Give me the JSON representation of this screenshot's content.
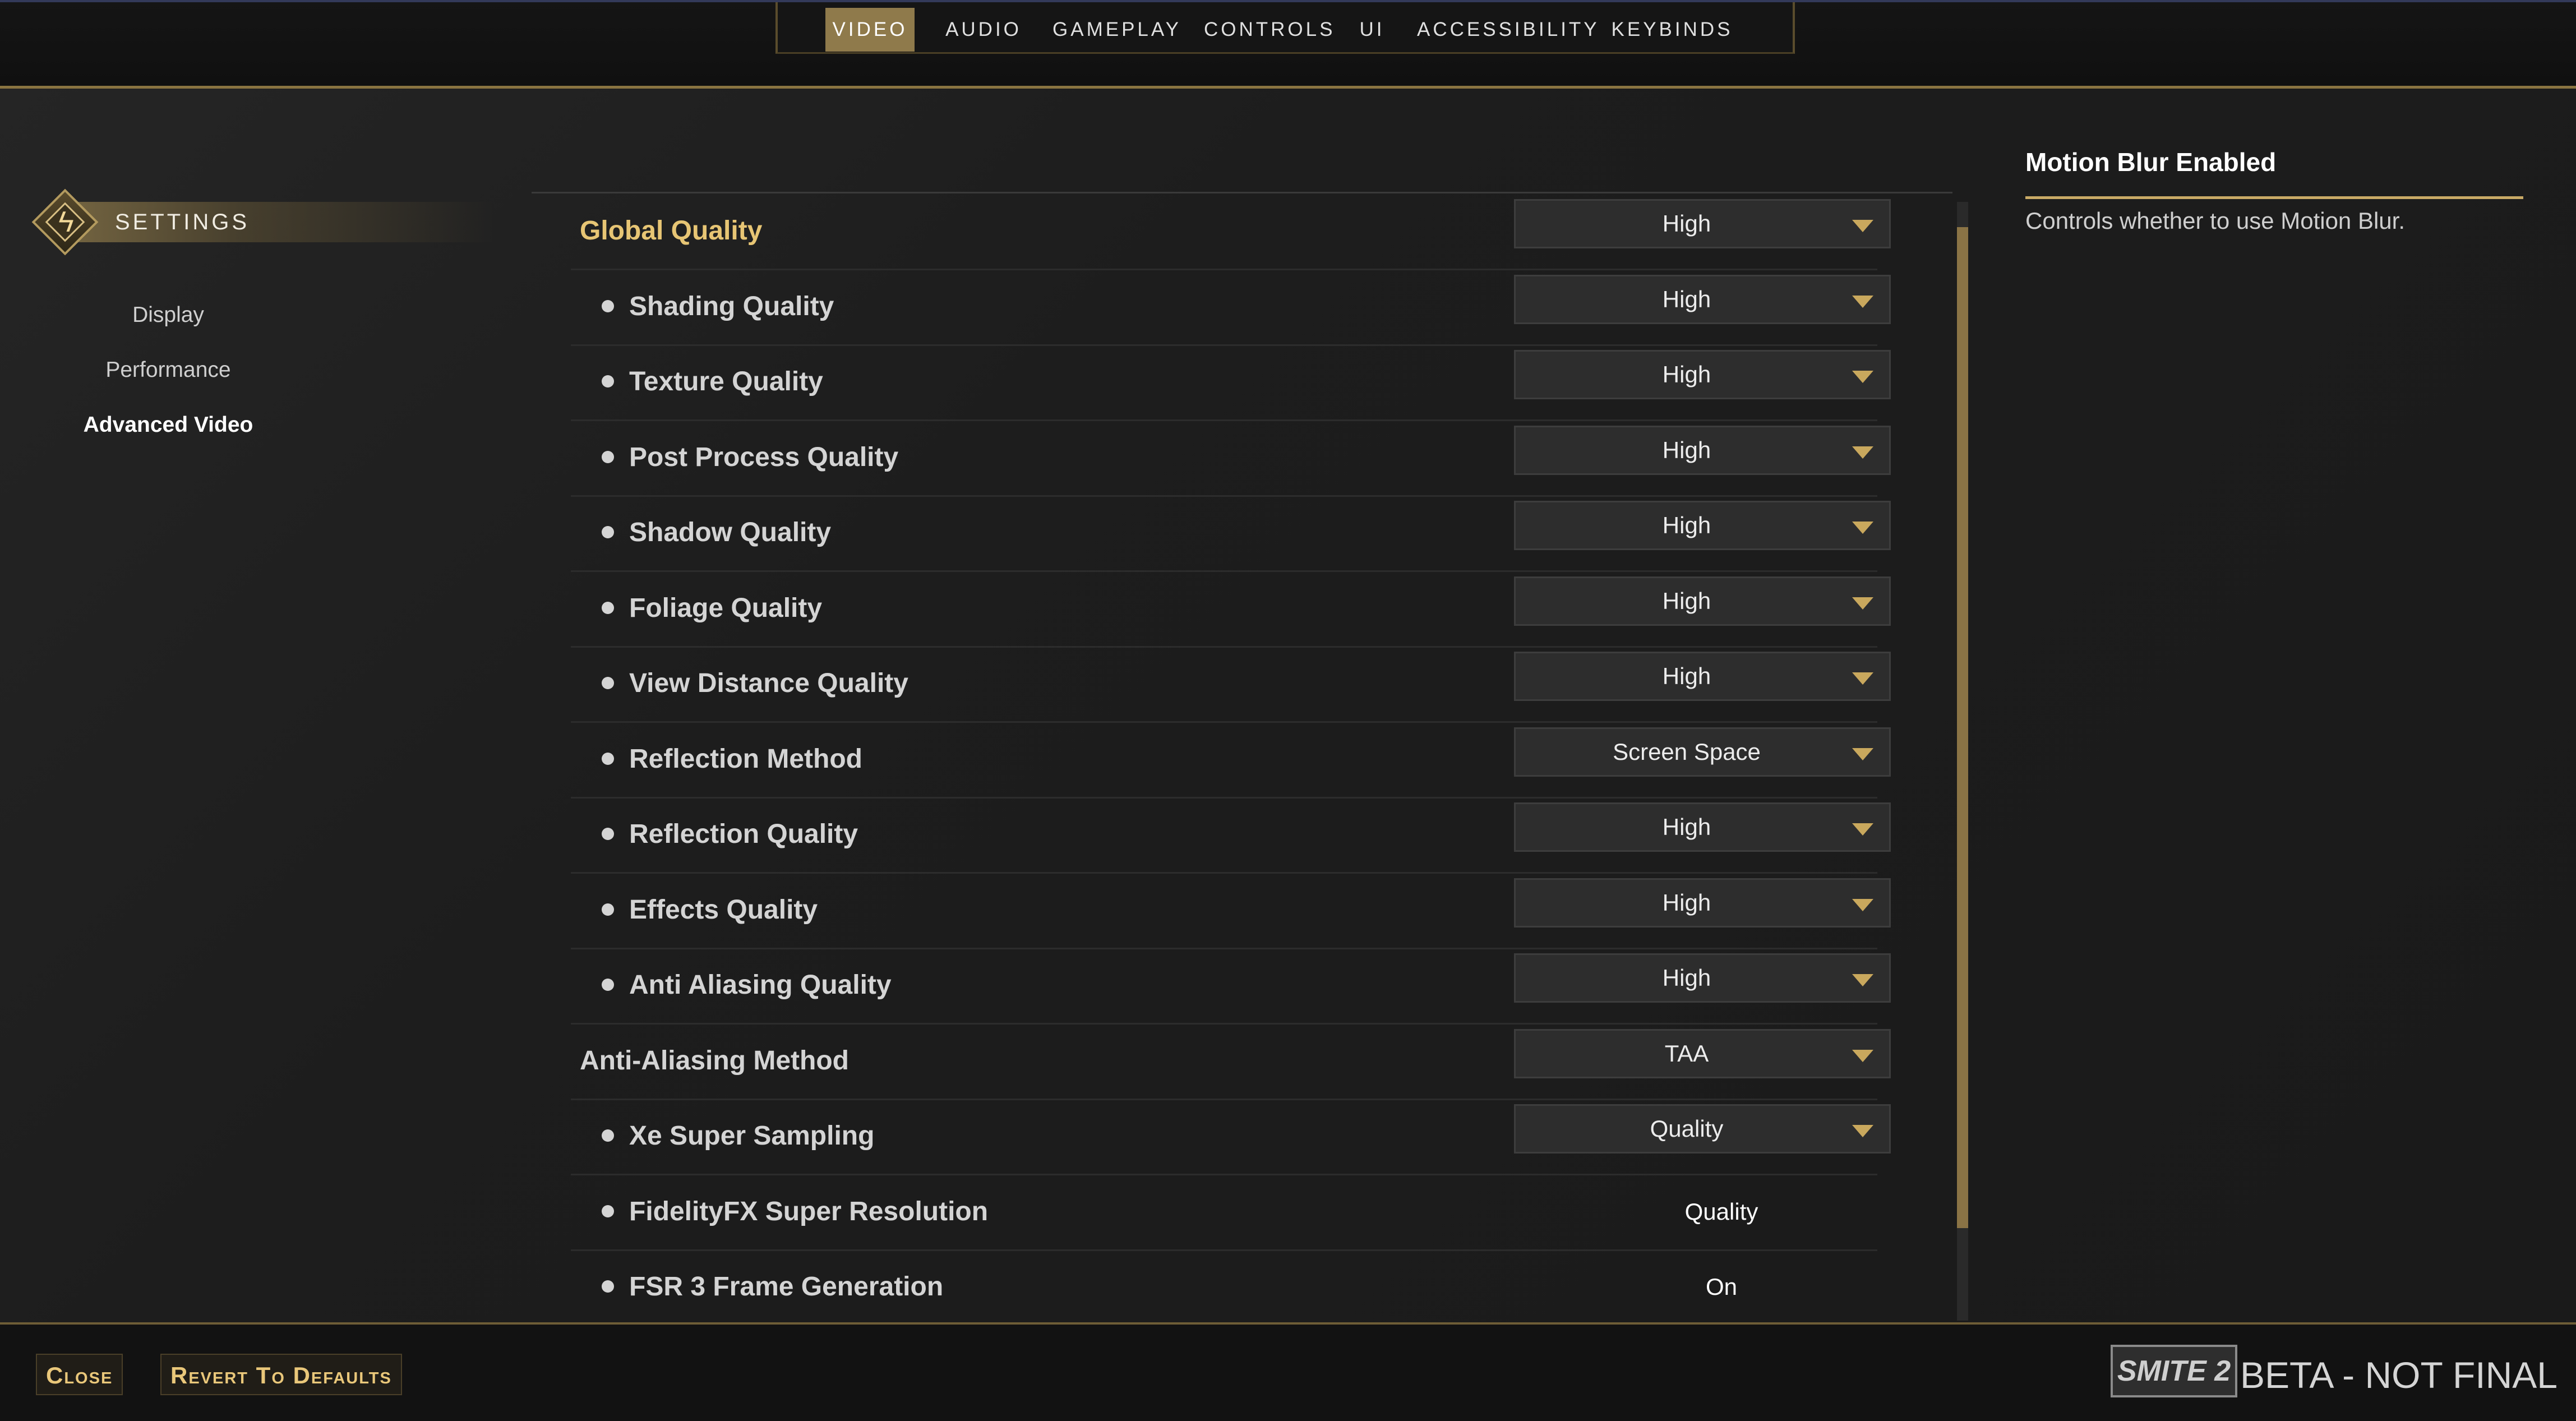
{
  "top_nav": {
    "tabs": [
      "VIDEO",
      "AUDIO",
      "GAMEPLAY",
      "CONTROLS",
      "UI",
      "ACCESSIBILITY",
      "KEYBINDS"
    ],
    "active_tab": "VIDEO"
  },
  "sidebar": {
    "title": "SETTINGS",
    "icon": "lightning-bolt-icon",
    "items": [
      {
        "label": "Display"
      },
      {
        "label": "Performance"
      },
      {
        "label": "Advanced Video",
        "active": true
      }
    ]
  },
  "settings": [
    {
      "label": "Global Quality",
      "value": "High",
      "type": "dropdown",
      "sub": false,
      "highlight": true
    },
    {
      "label": "Shading Quality",
      "value": "High",
      "type": "dropdown",
      "sub": true
    },
    {
      "label": "Texture Quality",
      "value": "High",
      "type": "dropdown",
      "sub": true
    },
    {
      "label": "Post Process Quality",
      "value": "High",
      "type": "dropdown",
      "sub": true
    },
    {
      "label": "Shadow Quality",
      "value": "High",
      "type": "dropdown",
      "sub": true
    },
    {
      "label": "Foliage Quality",
      "value": "High",
      "type": "dropdown",
      "sub": true
    },
    {
      "label": "View Distance Quality",
      "value": "High",
      "type": "dropdown",
      "sub": true
    },
    {
      "label": "Reflection Method",
      "value": "Screen Space",
      "type": "dropdown",
      "sub": true
    },
    {
      "label": "Reflection Quality",
      "value": "High",
      "type": "dropdown",
      "sub": true
    },
    {
      "label": "Effects Quality",
      "value": "High",
      "type": "dropdown",
      "sub": true
    },
    {
      "label": "Anti Aliasing Quality",
      "value": "High",
      "type": "dropdown",
      "sub": true
    },
    {
      "label": "Anti-Aliasing Method",
      "value": "TAA",
      "type": "dropdown",
      "sub": false
    },
    {
      "label": "Xe Super Sampling",
      "value": "Quality",
      "type": "dropdown",
      "sub": true
    },
    {
      "label": "FidelityFX Super Resolution",
      "value": "Quality",
      "type": "static",
      "sub": true
    },
    {
      "label": "FSR 3 Frame Generation",
      "value": "On",
      "type": "static",
      "sub": true
    }
  ],
  "help": {
    "title": "Motion Blur Enabled",
    "description": "Controls whether to use Motion Blur."
  },
  "footer": {
    "close_label": "Close",
    "revert_label": "Revert To Defaults",
    "logo_text": "SMITE 2",
    "beta_text": "BETA - NOT FINAL"
  },
  "colors": {
    "accent_gold": "#c9aa66",
    "highlight_label": "#e7c574",
    "active_tab_bg": "#8f7a4b"
  }
}
